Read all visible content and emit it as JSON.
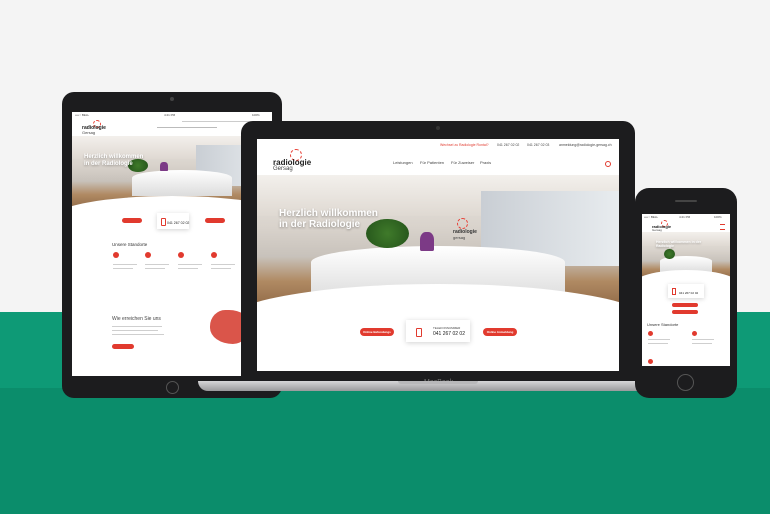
{
  "site": {
    "logo_main": "radiologie",
    "logo_sub": "Gersag",
    "hero_line1": "Herzlich willkommen",
    "hero_line2": "in der Radiologie",
    "hero_sign_main": "radiologie",
    "hero_sign_sub": "gersag"
  },
  "laptop": {
    "brand_label": "MacBook",
    "topbar": {
      "notice": "Wechsel zu Radiologie Rontal?",
      "phone": "041 267 02 02",
      "fax": "041 267 02 03",
      "email": "anmeldung@radiologie-gersag.ch"
    },
    "nav": [
      "Leistungen",
      "Für Patienten",
      "Für Zuweiser",
      "Praxis"
    ],
    "btn_left": "Online Befundungs",
    "btn_right": "Online Anmeldung",
    "phone_card_label": "TELEFONNUMMER",
    "phone_card_number": "041 267 02 02"
  },
  "tablet": {
    "status_carrier": "••••○ BELL",
    "status_time": "4:21 PM",
    "status_battery": "100%",
    "section_title": "Unsere Standorte",
    "phone_card_number": "041 267 02 02",
    "map_title": "Wie erreichen Sie uns"
  },
  "phone": {
    "status_carrier": "••••○ BELL",
    "status_time": "4:21 PM",
    "status_battery": "100%",
    "hero_text": "Herzlich willkommen in der Radiologie",
    "phone_card_number": "041 267 02 02",
    "section_title": "Unsere Standorte"
  },
  "colors": {
    "accent": "#e13a2e",
    "background_green": "#0e9a76",
    "device_frame": "#1c1c1e"
  }
}
